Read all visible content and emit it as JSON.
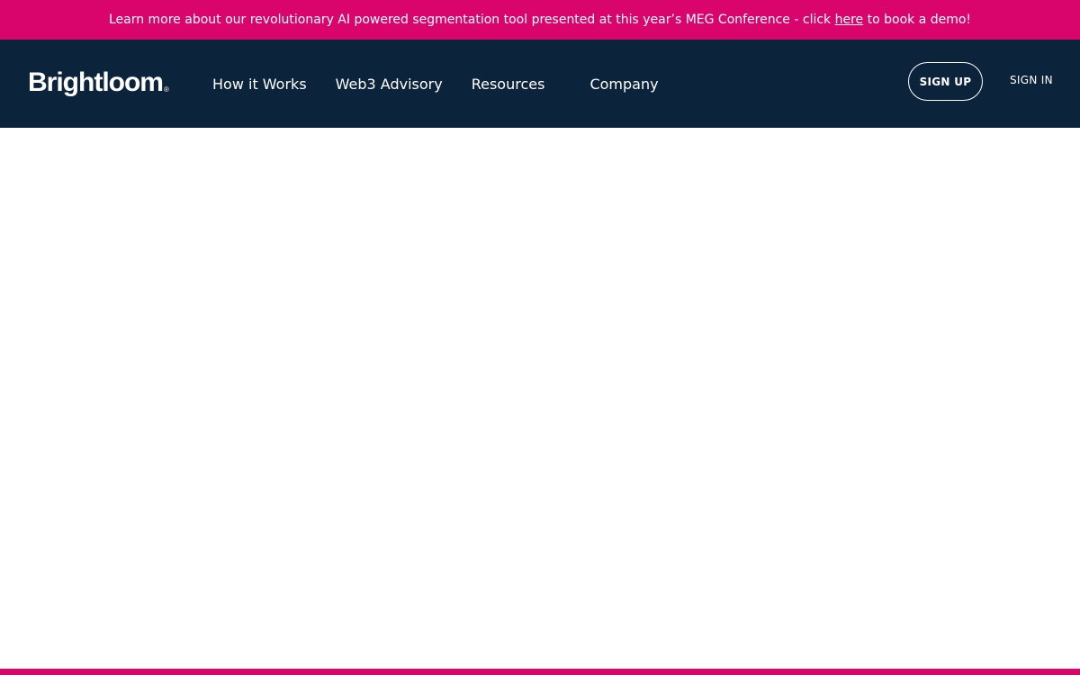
{
  "announcement": {
    "text_before": "Learn more about our revolutionary AI powered segmentation tool presented at this year’s MEG Conference - click ",
    "link_text": "here",
    "text_after": " to book a demo!"
  },
  "header": {
    "logo": {
      "text": "Brightloom",
      "mark": "®"
    },
    "nav": [
      {
        "label": "How it Works"
      },
      {
        "label": "Web3 Advisory"
      },
      {
        "label": "Resources"
      },
      {
        "label": "Company"
      }
    ],
    "sign_up_label": "SIGN UP",
    "sign_in_label": "SIGN IN"
  },
  "colors": {
    "accent_pink": "#d9046c",
    "navy": "#0b233b",
    "background": "#ffffff"
  }
}
